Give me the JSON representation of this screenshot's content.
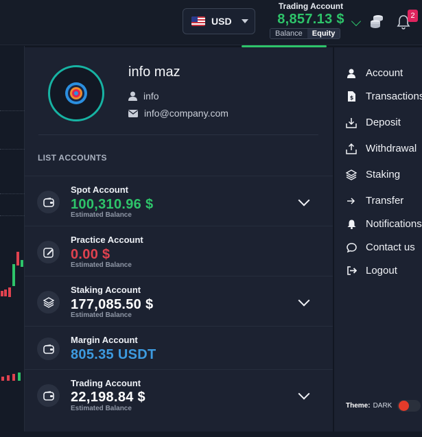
{
  "header": {
    "currency_code": "USD",
    "trading_label": "Trading Account",
    "trading_value": "8,857.13 $",
    "segment_balance": "Balance",
    "segment_equity": "Equity",
    "notification_count": "2"
  },
  "profile": {
    "name": "info maz",
    "username": "info",
    "email": "info@company.com"
  },
  "accounts": {
    "title": "LIST ACCOUNTS",
    "items": [
      {
        "name": "Spot Account",
        "value": "100,310.96 $",
        "sub": "Estimated Balance",
        "color": "#2ec46a"
      },
      {
        "name": "Practice Account",
        "value": "0.00 $",
        "sub": "Estimated Balance",
        "color": "#e0424f"
      },
      {
        "name": "Staking Account",
        "value": "177,085.50 $",
        "sub": "Estimated Balance",
        "color": "#ffffff"
      },
      {
        "name": "Margin Account",
        "value": "805.35 USDT",
        "color": "#3d9be0"
      },
      {
        "name": "Trading Account",
        "value": "22,198.84 $",
        "sub": "Estimated Balance",
        "color": "#ffffff"
      }
    ]
  },
  "menu": {
    "items": [
      {
        "label": "Account",
        "icon": "user-icon"
      },
      {
        "label": "Transactions",
        "icon": "receipt-icon"
      },
      {
        "label": "Deposit",
        "icon": "download-icon"
      },
      {
        "label": "Withdrawal",
        "icon": "upload-icon"
      },
      {
        "label": "Staking",
        "icon": "layers-icon"
      },
      {
        "label": "Transfer",
        "icon": "arrow-right-icon"
      },
      {
        "label": "Notifications",
        "icon": "bell-icon"
      },
      {
        "label": "Contact us",
        "icon": "chat-icon"
      },
      {
        "label": "Logout",
        "icon": "logout-icon"
      }
    ]
  },
  "theme": {
    "label": "Theme:",
    "value": "DARK"
  },
  "colors": {
    "accent_green": "#2ec46a",
    "negative_red": "#e0424f",
    "info_blue": "#3d9be0",
    "avatar_ring": "#17b3a3"
  }
}
